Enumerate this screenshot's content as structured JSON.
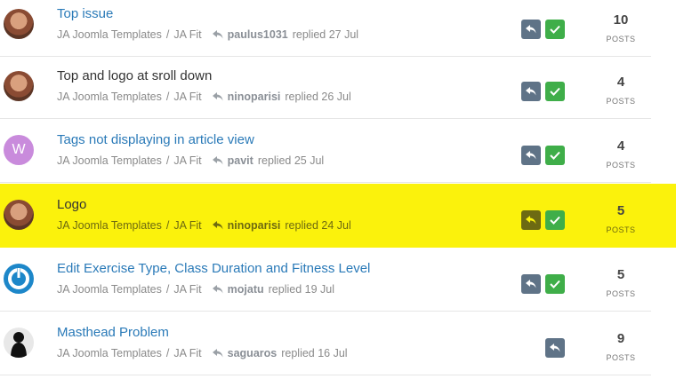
{
  "topics": [
    {
      "title": "Top issue",
      "category": "JA Joomla Templates",
      "subcategory": "JA Fit",
      "user": "paulus1031",
      "replied": "replied 27 Jul",
      "posts": "10",
      "posts_label": "POSTS",
      "avatar": "photo-avatar",
      "highlighted": false,
      "resolved": true
    },
    {
      "title": "Top and logo at sroll down",
      "category": "JA Joomla Templates",
      "subcategory": "JA Fit",
      "user": "ninoparisi",
      "replied": "replied 26 Jul",
      "posts": "4",
      "posts_label": "POSTS",
      "avatar": "photo-avatar",
      "highlighted": false,
      "resolved": true
    },
    {
      "title": "Tags not displaying in article view",
      "category": "JA Joomla Templates",
      "subcategory": "JA Fit",
      "user": "pavit",
      "replied": "replied 25 Jul",
      "posts": "4",
      "posts_label": "POSTS",
      "avatar": "letter-avatar",
      "avatar_letter": "W",
      "highlighted": false,
      "resolved": true
    },
    {
      "title": "Logo",
      "category": "JA Joomla Templates",
      "subcategory": "JA Fit",
      "user": "ninoparisi",
      "replied": "replied 24 Jul",
      "posts": "5",
      "posts_label": "POSTS",
      "avatar": "photo-avatar",
      "highlighted": true,
      "resolved": true
    },
    {
      "title": "Edit Exercise Type, Class Duration and Fitness Level",
      "category": "JA Joomla Templates",
      "subcategory": "JA Fit",
      "user": "mojatu",
      "replied": "replied 19 Jul",
      "posts": "5",
      "posts_label": "POSTS",
      "avatar": "power-avatar",
      "highlighted": false,
      "resolved": true
    },
    {
      "title": "Masthead Problem",
      "category": "JA Joomla Templates",
      "subcategory": "JA Fit",
      "user": "saguaros",
      "replied": "replied 16 Jul",
      "posts": "9",
      "posts_label": "POSTS",
      "avatar": "silhouette-avatar",
      "highlighted": false,
      "resolved": false
    }
  ],
  "colors": {
    "link": "#2a7ab8",
    "highlight": "#fbf20c",
    "reply_button": "#5f7387",
    "resolved_button": "#3fae49",
    "letter_avatar": "#c98bdc"
  },
  "icons": {
    "reply": "reply-icon",
    "resolved": "check-icon"
  }
}
